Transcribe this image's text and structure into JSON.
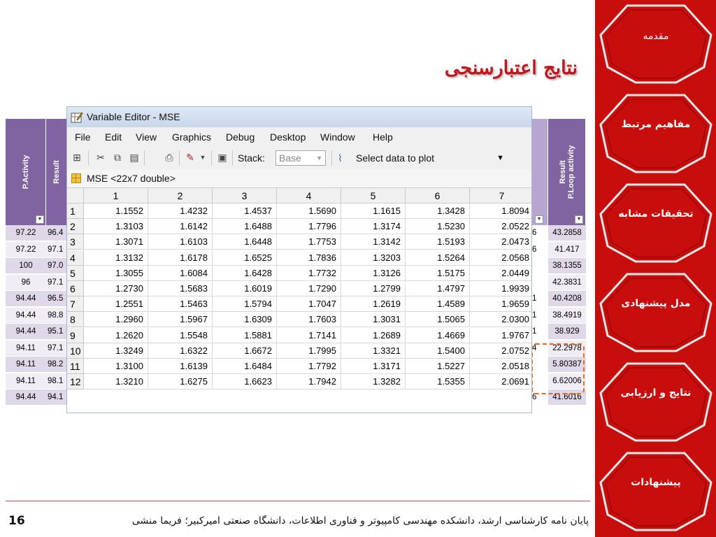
{
  "slide": {
    "title": "نتایج اعتبارسنجی",
    "page_number": "16",
    "footer": "پایان نامه کارشناسی ارشد، دانشکده مهندسی کامپیوتر و فناوری اطلاعات، دانشگاه صنعتی امیرکبیر؛ فریما منشی"
  },
  "sidebar": {
    "items": [
      {
        "label": "مقدمه"
      },
      {
        "label": "مفاهیم مرتبط"
      },
      {
        "label": "تحقیقات مشابه"
      },
      {
        "label": "مدل پیشنهادی"
      },
      {
        "label": "نتایج و ارزیابی"
      },
      {
        "label": "پیشنهادات"
      }
    ]
  },
  "left_table": {
    "headers": [
      "P.Activity",
      "Result"
    ],
    "rows": [
      [
        "97.22",
        "96.4"
      ],
      [
        "97.22",
        "97.1"
      ],
      [
        "100",
        "97.0"
      ],
      [
        "96",
        "97.1"
      ],
      [
        "94.44",
        "96.5"
      ],
      [
        "94.44",
        "98.8"
      ],
      [
        "94.44",
        "95.1"
      ],
      [
        "94.11",
        "97.1"
      ],
      [
        "94.11",
        "98.2"
      ],
      [
        "94.11",
        "98.1"
      ],
      [
        "94.44",
        "94.1"
      ]
    ]
  },
  "right_table": {
    "header_line1": "Result",
    "header_line2": "P.Loop activity",
    "partial_col": [
      "6",
      "6",
      "",
      "",
      "1",
      "1",
      "1",
      "4",
      "",
      "",
      "6"
    ],
    "rows": [
      "43.2858",
      "41.417",
      "38.1355",
      "42.3831",
      "40.4208",
      "38.4919",
      "38.929",
      "22.2978",
      "5.80387",
      "6.62006",
      "41.6016"
    ]
  },
  "editor": {
    "window_title": "Variable Editor - MSE",
    "menu": [
      "File",
      "Edit",
      "View",
      "Graphics",
      "Debug",
      "Desktop",
      "Window",
      "Help"
    ],
    "stack_label": "Stack:",
    "stack_value": "Base",
    "plot_select": "Select data to plot",
    "variable_label": "MSE <22x7 double>",
    "columns": [
      "1",
      "2",
      "3",
      "4",
      "5",
      "6",
      "7"
    ],
    "rows": [
      {
        "n": "1",
        "v": [
          "1.1552",
          "1.4232",
          "1.4537",
          "1.5690",
          "1.1615",
          "1.3428",
          "1.8094"
        ]
      },
      {
        "n": "2",
        "v": [
          "1.3103",
          "1.6142",
          "1.6488",
          "1.7796",
          "1.3174",
          "1.5230",
          "2.0522"
        ]
      },
      {
        "n": "3",
        "v": [
          "1.3071",
          "1.6103",
          "1.6448",
          "1.7753",
          "1.3142",
          "1.5193",
          "2.0473"
        ]
      },
      {
        "n": "4",
        "v": [
          "1.3132",
          "1.6178",
          "1.6525",
          "1.7836",
          "1.3203",
          "1.5264",
          "2.0568"
        ]
      },
      {
        "n": "5",
        "v": [
          "1.3055",
          "1.6084",
          "1.6428",
          "1.7732",
          "1.3126",
          "1.5175",
          "2.0449"
        ]
      },
      {
        "n": "6",
        "v": [
          "1.2730",
          "1.5683",
          "1.6019",
          "1.7290",
          "1.2799",
          "1.4797",
          "1.9939"
        ]
      },
      {
        "n": "7",
        "v": [
          "1.2551",
          "1.5463",
          "1.5794",
          "1.7047",
          "1.2619",
          "1.4589",
          "1.9659"
        ]
      },
      {
        "n": "8",
        "v": [
          "1.2960",
          "1.5967",
          "1.6309",
          "1.7603",
          "1.3031",
          "1.5065",
          "2.0300"
        ]
      },
      {
        "n": "9",
        "v": [
          "1.2620",
          "1.5548",
          "1.5881",
          "1.7141",
          "1.2689",
          "1.4669",
          "1.9767"
        ]
      },
      {
        "n": "10",
        "v": [
          "1.3249",
          "1.6322",
          "1.6672",
          "1.7995",
          "1.3321",
          "1.5400",
          "2.0752"
        ]
      },
      {
        "n": "11",
        "v": [
          "1.3100",
          "1.6139",
          "1.6484",
          "1.7792",
          "1.3171",
          "1.5227",
          "2.0518"
        ]
      },
      {
        "n": "12",
        "v": [
          "1.3210",
          "1.6275",
          "1.6623",
          "1.7942",
          "1.3282",
          "1.5355",
          "2.0691"
        ]
      }
    ]
  },
  "colors": {
    "sidebar_red": "#c80d0d",
    "title_red": "#c0161d",
    "table_header": "#8064a2",
    "highlight": "#e86a24"
  }
}
